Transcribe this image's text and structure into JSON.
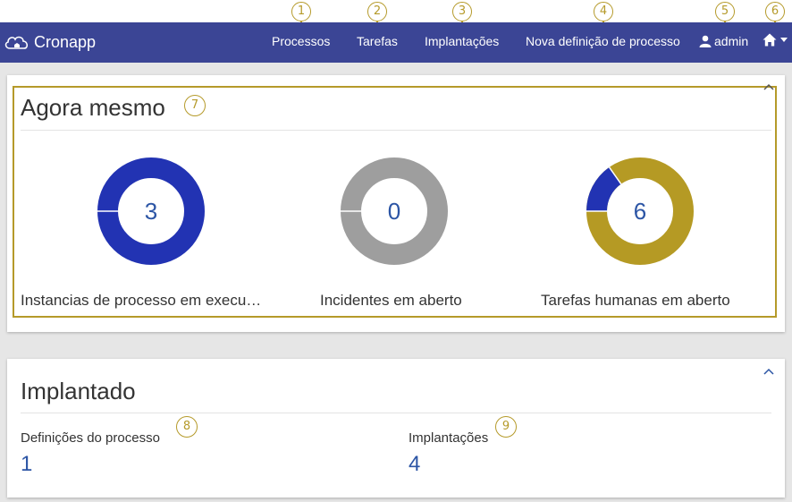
{
  "navbar": {
    "brand": "Cronapp",
    "items": [
      {
        "label": "Processos"
      },
      {
        "label": "Tarefas"
      },
      {
        "label": "Implantações"
      },
      {
        "label": "Nova definição de processo"
      }
    ],
    "user": "admin"
  },
  "callouts": [
    "1",
    "2",
    "3",
    "4",
    "5",
    "6",
    "7",
    "8",
    "9"
  ],
  "now_panel": {
    "title": "Agora mesmo",
    "cards": [
      {
        "value": "3",
        "label": "Instancias de processo em execu…"
      },
      {
        "value": "0",
        "label": "Incidentes em aberto"
      },
      {
        "value": "6",
        "label": "Tarefas humanas em aberto"
      }
    ]
  },
  "deployed_panel": {
    "title": "Implantado",
    "stats": [
      {
        "label": "Definições do processo",
        "value": "1"
      },
      {
        "label": "Implantações",
        "value": "4"
      }
    ]
  },
  "colors": {
    "navbar": "#3b4595",
    "accent_blue": "#2233b3",
    "gray": "#9e9e9e",
    "gold": "#b59a24",
    "value_text": "#2c55a5",
    "callout": "#b59a2a"
  },
  "icons": {
    "brand": "cloud-icon",
    "user": "user-icon",
    "home": "home-icon",
    "caret": "caret-down-icon",
    "collapse": "chevron-up-icon"
  }
}
